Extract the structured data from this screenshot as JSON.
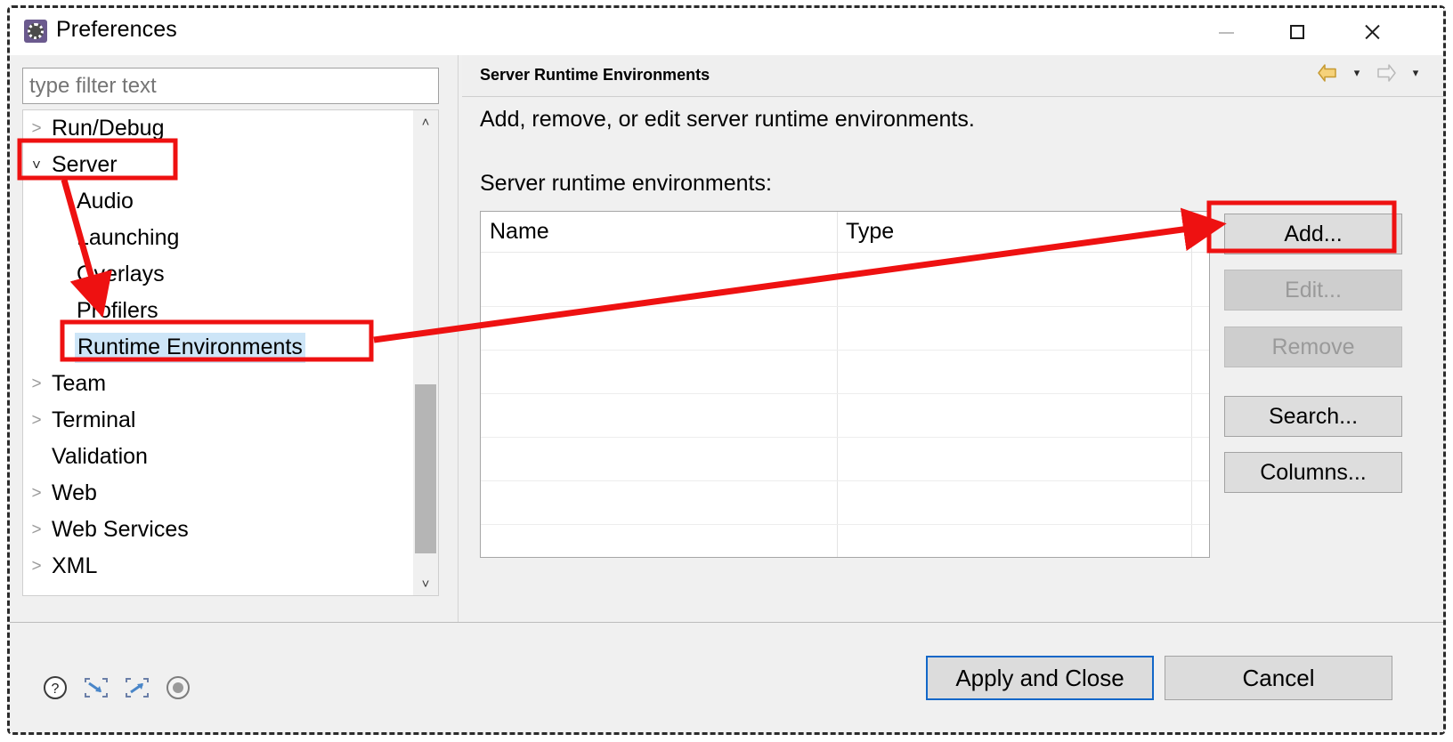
{
  "window": {
    "title": "Preferences",
    "icon": "preferences-gear-icon",
    "controls": {
      "minimize": "minimize-icon",
      "maximize": "maximize-icon",
      "close": "close-icon"
    }
  },
  "sidebar": {
    "filter": {
      "placeholder": "type filter text",
      "value": ""
    },
    "items": [
      {
        "label": "Run/Debug",
        "twisty": ">",
        "indent": false,
        "selected": false
      },
      {
        "label": "Server",
        "twisty": "˅",
        "indent": false,
        "selected": false,
        "expanded": true
      },
      {
        "label": "Audio",
        "twisty": "",
        "indent": true,
        "selected": false
      },
      {
        "label": "Launching",
        "twisty": "",
        "indent": true,
        "selected": false
      },
      {
        "label": "Overlays",
        "twisty": "",
        "indent": true,
        "selected": false
      },
      {
        "label": "Profilers",
        "twisty": "",
        "indent": true,
        "selected": false
      },
      {
        "label": "Runtime Environments",
        "twisty": "",
        "indent": true,
        "selected": true
      },
      {
        "label": "Team",
        "twisty": ">",
        "indent": false,
        "selected": false
      },
      {
        "label": "Terminal",
        "twisty": ">",
        "indent": false,
        "selected": false
      },
      {
        "label": "Validation",
        "twisty": "",
        "indent": false,
        "selected": false
      },
      {
        "label": "Web",
        "twisty": ">",
        "indent": false,
        "selected": false
      },
      {
        "label": "Web Services",
        "twisty": ">",
        "indent": false,
        "selected": false
      },
      {
        "label": "XML",
        "twisty": ">",
        "indent": false,
        "selected": false
      }
    ],
    "scroll_up": "˄",
    "scroll_down": "˅"
  },
  "page": {
    "title": "Server Runtime Environments",
    "description": "Add, remove, or edit server runtime environments.",
    "list_label": "Server runtime environments:",
    "nav": {
      "back_icon": "back-arrow-icon",
      "back_menu_icon": "chevron-down-icon",
      "forward_icon": "forward-arrow-icon",
      "forward_menu_icon": "chevron-down-icon",
      "caret": "▾"
    },
    "table": {
      "columns": [
        "Name",
        "Type"
      ],
      "rows": []
    },
    "buttons": [
      {
        "label": "Add...",
        "enabled": true,
        "name": "add-button"
      },
      {
        "label": "Edit...",
        "enabled": false,
        "name": "edit-button"
      },
      {
        "label": "Remove",
        "enabled": false,
        "name": "remove-button"
      },
      {
        "label": "Search...",
        "enabled": true,
        "name": "search-button"
      },
      {
        "label": "Columns...",
        "enabled": true,
        "name": "columns-button"
      }
    ]
  },
  "footer": {
    "icons": [
      "help-icon",
      "import-icon",
      "export-icon",
      "record-icon"
    ],
    "apply_label": "Apply and Close",
    "cancel_label": "Cancel"
  },
  "annotations": {
    "highlight_color": "#ee1111",
    "boxes": [
      "server-tree-item",
      "runtime-environments-tree-item",
      "add-button"
    ],
    "arrows": [
      "server-to-runtime-environments",
      "runtime-environments-to-add-button"
    ]
  },
  "colors": {
    "selection": "#cde5f7",
    "focus_border": "#1267c8",
    "annotation_red": "#ee1111",
    "window_bg": "#f0f0f0"
  }
}
